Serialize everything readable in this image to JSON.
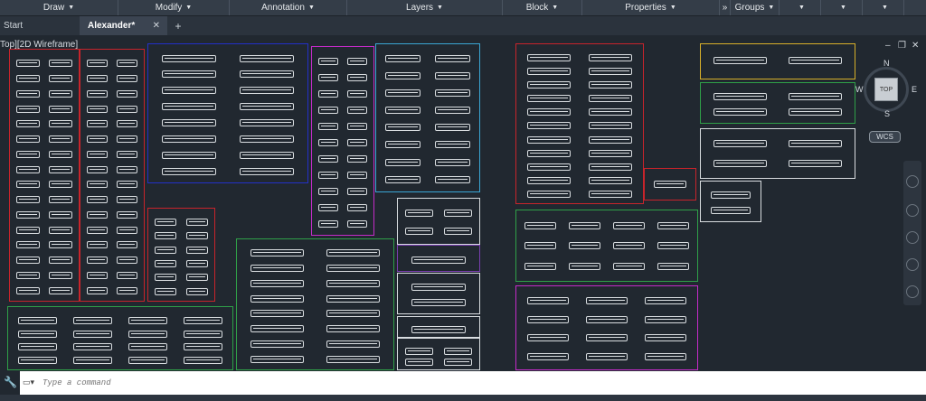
{
  "ribbon": {
    "panels": [
      {
        "label": "Draw",
        "caret": "▼"
      },
      {
        "label": "Modify",
        "caret": "▼"
      },
      {
        "label": "Annotation",
        "caret": "▼"
      },
      {
        "label": "Layers",
        "caret": "▼"
      },
      {
        "label": "Block",
        "caret": "▼"
      },
      {
        "label": "Properties",
        "caret": "▼"
      },
      {
        "label": "»",
        "caret": ""
      },
      {
        "label": "Groups",
        "caret": "▼"
      },
      {
        "label": "",
        "caret": "▼"
      },
      {
        "label": "",
        "caret": "▼"
      },
      {
        "label": "",
        "caret": "▼"
      }
    ]
  },
  "tabs": {
    "start": "Start",
    "document": "Alexander*",
    "close": "✕",
    "new_tab": "+"
  },
  "viewport": {
    "label": "Top][2D Wireframe]"
  },
  "navcube": {
    "face": "TOP",
    "n": "N",
    "s": "S",
    "e": "E",
    "w": "W",
    "wcs": "WCS"
  },
  "window_controls": {
    "minimize": "–",
    "restore": "❐",
    "close": "✕"
  },
  "command": {
    "placeholder": "Type a command",
    "icon": "command-icon"
  },
  "colors": {
    "red": "#c8242b",
    "blue": "#2330c8",
    "magenta": "#c42bc8",
    "cyan": "#3aa6d4",
    "white": "#d9dde0",
    "green": "#2fa048",
    "yellow": "#d8b02a",
    "purple": "#7a3fb0",
    "canvas": "#212830"
  }
}
